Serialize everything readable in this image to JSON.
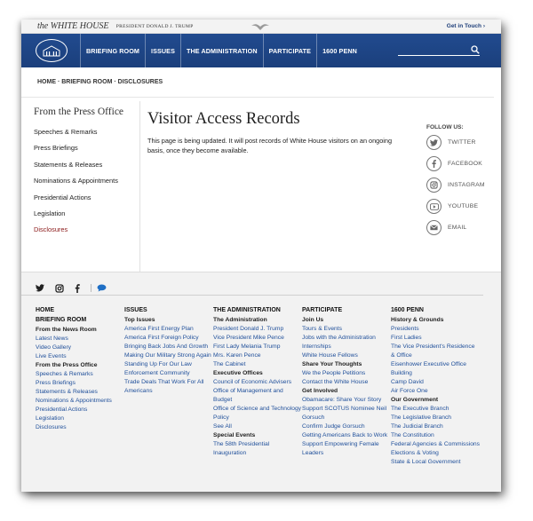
{
  "topbar": {
    "site_name": "the WHITE HOUSE",
    "president_label": "PRESIDENT DONALD J. TRUMP",
    "get_in_touch": "Get in Touch"
  },
  "nav": {
    "items": [
      "BRIEFING ROOM",
      "ISSUES",
      "THE ADMINISTRATION",
      "PARTICIPATE",
      "1600 PENN"
    ],
    "search_placeholder": ""
  },
  "breadcrumb": [
    "HOME",
    "BRIEFING ROOM",
    "DISCLOSURES"
  ],
  "breadcrumb_separator": " · ",
  "sidebar": {
    "heading": "From the Press Office",
    "items": [
      "Speeches & Remarks",
      "Press Briefings",
      "Statements & Releases",
      "Nominations & Appointments",
      "Presidential Actions",
      "Legislation",
      "Disclosures"
    ]
  },
  "main": {
    "title": "Visitor Access Records",
    "body": "This page is being updated. It will post records of White House visitors on an ongoing basis, once they become available."
  },
  "follow": {
    "title": "FOLLOW US:",
    "items": [
      {
        "label": "TWITTER",
        "icon": "twitter-icon"
      },
      {
        "label": "FACEBOOK",
        "icon": "facebook-icon"
      },
      {
        "label": "INSTAGRAM",
        "icon": "instagram-icon"
      },
      {
        "label": "YOUTUBE",
        "icon": "youtube-icon"
      },
      {
        "label": "EMAIL",
        "icon": "email-icon"
      }
    ]
  },
  "footer": {
    "columns": [
      {
        "title": "HOME",
        "entries": [
          {
            "t": "h",
            "v": "BRIEFING ROOM"
          },
          {
            "t": "s",
            "v": "From the News Room"
          },
          {
            "t": "l",
            "v": "Latest News"
          },
          {
            "t": "l",
            "v": "Video Gallery"
          },
          {
            "t": "l",
            "v": "Live Events"
          },
          {
            "t": "s",
            "v": "From the Press Office"
          },
          {
            "t": "l",
            "v": "Speeches & Remarks"
          },
          {
            "t": "l",
            "v": "Press Briefings"
          },
          {
            "t": "l",
            "v": "Statements & Releases"
          },
          {
            "t": "l",
            "v": "Nominations & Appointments"
          },
          {
            "t": "l",
            "v": "Presidential Actions"
          },
          {
            "t": "l",
            "v": "Legislation"
          },
          {
            "t": "l",
            "v": "Disclosures"
          }
        ]
      },
      {
        "title": "ISSUES",
        "entries": [
          {
            "t": "s",
            "v": "Top Issues"
          },
          {
            "t": "l",
            "v": "America First Energy Plan"
          },
          {
            "t": "l",
            "v": "America First Foreign Policy"
          },
          {
            "t": "l",
            "v": "Bringing Back Jobs And Growth"
          },
          {
            "t": "l",
            "v": "Making Our Military Strong Again"
          },
          {
            "t": "l",
            "v": "Standing Up For Our Law Enforcement Community"
          },
          {
            "t": "l",
            "v": "Trade Deals That Work For All Americans"
          }
        ]
      },
      {
        "title": "THE ADMINISTRATION",
        "entries": [
          {
            "t": "s",
            "v": "The Administration"
          },
          {
            "t": "l",
            "v": "President Donald J. Trump"
          },
          {
            "t": "l",
            "v": "Vice President Mike Pence"
          },
          {
            "t": "l",
            "v": "First Lady Melania Trump"
          },
          {
            "t": "l",
            "v": "Mrs. Karen Pence"
          },
          {
            "t": "l",
            "v": "The Cabinet"
          },
          {
            "t": "s",
            "v": "Executive Offices"
          },
          {
            "t": "l",
            "v": "Council of Economic Advisers"
          },
          {
            "t": "l",
            "v": "Office of Management and Budget"
          },
          {
            "t": "l",
            "v": "Office of Science and Technology Policy"
          },
          {
            "t": "l",
            "v": "See All"
          },
          {
            "t": "s",
            "v": "Special Events"
          },
          {
            "t": "l",
            "v": "The 58th Presidential Inauguration"
          }
        ]
      },
      {
        "title": "PARTICIPATE",
        "entries": [
          {
            "t": "s",
            "v": "Join Us"
          },
          {
            "t": "l",
            "v": "Tours & Events"
          },
          {
            "t": "l",
            "v": "Jobs with the Administration"
          },
          {
            "t": "l",
            "v": "Internships"
          },
          {
            "t": "l",
            "v": "White House Fellows"
          },
          {
            "t": "s",
            "v": "Share Your Thoughts"
          },
          {
            "t": "l",
            "v": "We the People Petitions"
          },
          {
            "t": "l",
            "v": "Contact the White House"
          },
          {
            "t": "s",
            "v": "Get Involved"
          },
          {
            "t": "l",
            "v": "Obamacare: Share Your Story"
          },
          {
            "t": "l",
            "v": "Support SCOTUS Nominee Neil Gorsuch"
          },
          {
            "t": "l",
            "v": "Confirm Judge Gorsuch"
          },
          {
            "t": "l",
            "v": "Getting Americans Back to Work"
          },
          {
            "t": "l",
            "v": "Support Empowering Female Leaders"
          }
        ]
      },
      {
        "title": "1600 PENN",
        "entries": [
          {
            "t": "s",
            "v": "History & Grounds"
          },
          {
            "t": "l",
            "v": "Presidents"
          },
          {
            "t": "l",
            "v": "First Ladies"
          },
          {
            "t": "l",
            "v": "The Vice President's Residence & Office"
          },
          {
            "t": "l",
            "v": "Eisenhower Executive Office Building"
          },
          {
            "t": "l",
            "v": "Camp David"
          },
          {
            "t": "l",
            "v": "Air Force One"
          },
          {
            "t": "s",
            "v": "Our Government"
          },
          {
            "t": "l",
            "v": "The Executive Branch"
          },
          {
            "t": "l",
            "v": "The Legislative Branch"
          },
          {
            "t": "l",
            "v": "The Judicial Branch"
          },
          {
            "t": "l",
            "v": "The Constitution"
          },
          {
            "t": "l",
            "v": "Federal Agencies & Commissions"
          },
          {
            "t": "l",
            "v": "Elections & Voting"
          },
          {
            "t": "l",
            "v": "State & Local Government"
          }
        ]
      }
    ],
    "social_icons": [
      "twitter-icon",
      "instagram-icon",
      "facebook-icon",
      "chat-icon"
    ]
  },
  "colors": {
    "nav_blue": "#1e4688",
    "link_blue": "#1f4f9a",
    "active_red": "#8b1a1a"
  }
}
